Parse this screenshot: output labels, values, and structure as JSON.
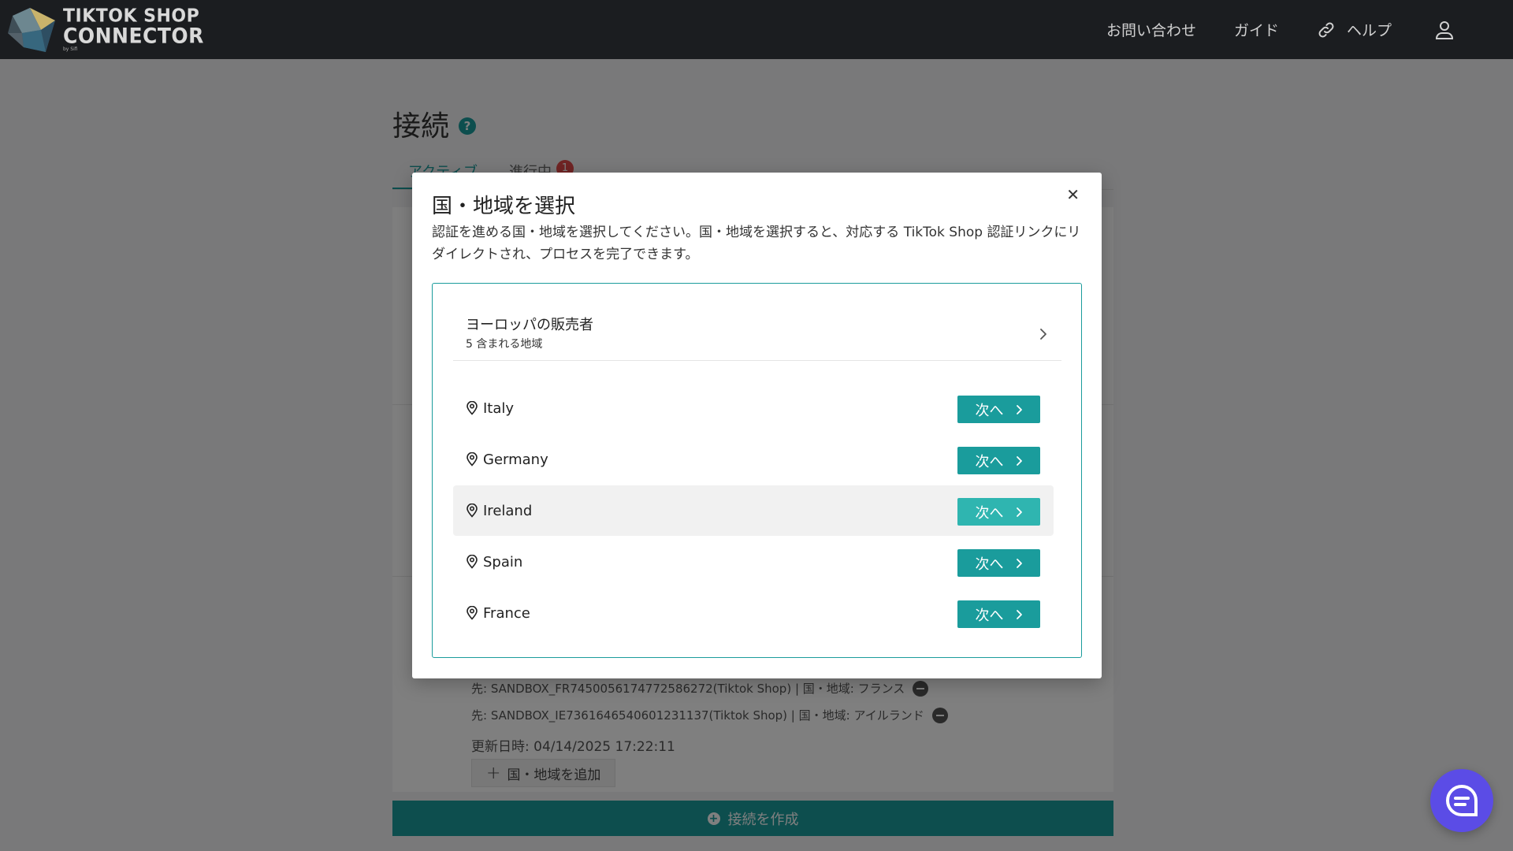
{
  "header": {
    "logo_line1": "TIKTOK SHOP",
    "logo_line2": "CONNECTOR",
    "logo_by": "by Sifi",
    "nav": {
      "contact": "お問い合わせ",
      "guide": "ガイド",
      "help": "ヘルプ"
    }
  },
  "page": {
    "title": "接続",
    "tabs": [
      {
        "label": "アクティブ"
      },
      {
        "label": "進行中",
        "badge": "1"
      }
    ],
    "destinations": [
      "先: SANDBOX_FR7450056174772586272(Tiktok Shop) | 国・地域: フランス",
      "先: SANDBOX_IE7361646540601231137(Tiktok Shop) | 国・地域: アイルランド"
    ],
    "updated": "更新日時: 04/14/2025 17:22:11",
    "add_region_label": "国・地域を追加",
    "create_label": "接続を作成"
  },
  "modal": {
    "title": "国・地域を選択",
    "description": "認証を進める国・地域を選択してください。国・地域を選択すると、対応する TikTok Shop 認証リンクにリダイレクトされ、プロセスを完了できます。",
    "group": {
      "name": "ヨーロッパの販売者",
      "count": "5 含まれる地域"
    },
    "next_label": "次へ",
    "regions": [
      {
        "name": "Italy"
      },
      {
        "name": "Germany"
      },
      {
        "name": "Ireland"
      },
      {
        "name": "Spain"
      },
      {
        "name": "France"
      }
    ]
  },
  "colors": {
    "accent": "#1a9c9c",
    "header_bg": "#1b1d20",
    "chat": "#5b4ce6"
  }
}
